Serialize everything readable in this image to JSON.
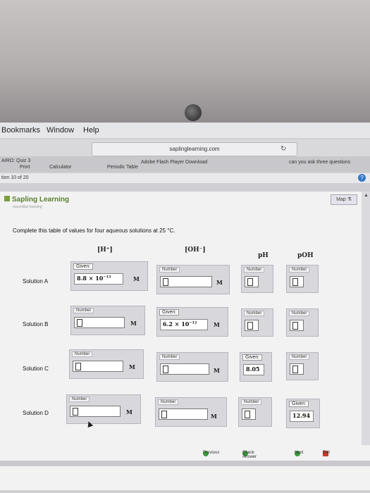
{
  "menu": {
    "bookmarks": "Bookmarks",
    "window": "Window",
    "help": "Help"
  },
  "browser": {
    "url": "saplinglearning.com",
    "tab_left": "AIRO: Quiz 3",
    "flash_notice": "Adobe Flash Player Download",
    "periodic_table": "Periodic Table",
    "print": "Print",
    "calculator": "Calculator",
    "question_counter": "tion 10 of 20",
    "right_tab": "can you ask three questions"
  },
  "app": {
    "logo": "Sapling Learning",
    "logo_sub": "macmillan learning",
    "map_button": "Map",
    "instruction": "Complete this table of values for four aqueous solutions at 25 °C.",
    "headers": {
      "h": "[H⁺]",
      "oh": "[OH⁻]",
      "ph": "pH",
      "poh": "pOH"
    },
    "unit": "M",
    "field_label": "Number",
    "given_label": "Given:",
    "rows": [
      {
        "label": "Solution A",
        "given_col": "h",
        "given_value_base": "8.8 × 10",
        "given_value_exp": "−13"
      },
      {
        "label": "Solution B",
        "given_col": "oh",
        "given_value_base": "6.2 × 10",
        "given_value_exp": "−12"
      },
      {
        "label": "Solution C",
        "given_col": "ph",
        "given_value": "8.05"
      },
      {
        "label": "Solution D",
        "given_col": "poh",
        "given_value": "12.94"
      }
    ],
    "nav": {
      "previous": "Previous",
      "check": "Check Answer",
      "next": "Next",
      "exit": "Exit"
    }
  },
  "colors": {
    "accent_green": "#5a7f2e",
    "check_green": "#3c9a3c",
    "exit_red": "#c63b2b"
  }
}
